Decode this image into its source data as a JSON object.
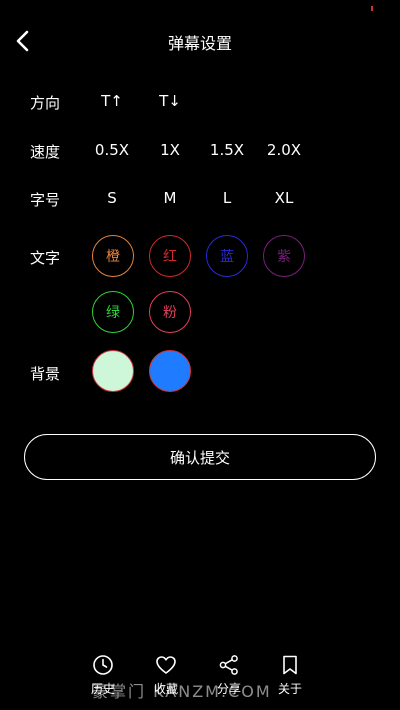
{
  "header": {
    "title": "弹幕设置"
  },
  "rows": {
    "direction": {
      "label": "方向",
      "options": [
        "T↑",
        "T↓"
      ]
    },
    "speed": {
      "label": "速度",
      "options": [
        "0.5X",
        "1X",
        "1.5X",
        "2.0X"
      ]
    },
    "size": {
      "label": "字号",
      "options": [
        "S",
        "M",
        "L",
        "XL"
      ]
    },
    "text_color": {
      "label": "文字",
      "options": [
        {
          "label": "橙",
          "color": "#e8823a"
        },
        {
          "label": "红",
          "color": "#d02a2a"
        },
        {
          "label": "蓝",
          "color": "#2a2ad6"
        },
        {
          "label": "紫",
          "color": "#7a1f7a"
        },
        {
          "label": "绿",
          "color": "#2fd23a"
        },
        {
          "label": "粉",
          "color": "#e0405a"
        }
      ]
    },
    "background": {
      "label": "背景",
      "options": [
        {
          "name": "mint",
          "color": "#cdf7d8"
        },
        {
          "name": "blue",
          "color": "#1f7bff"
        }
      ]
    }
  },
  "submit_label": "确认提交",
  "tabbar": {
    "items": [
      {
        "label": "历史",
        "icon": "clock-icon"
      },
      {
        "label": "收藏",
        "icon": "heart-icon"
      },
      {
        "label": "分享",
        "icon": "share-icon"
      },
      {
        "label": "关于",
        "icon": "bookmark-icon"
      }
    ]
  },
  "watermark": "豪掌门 KANZM.COM"
}
